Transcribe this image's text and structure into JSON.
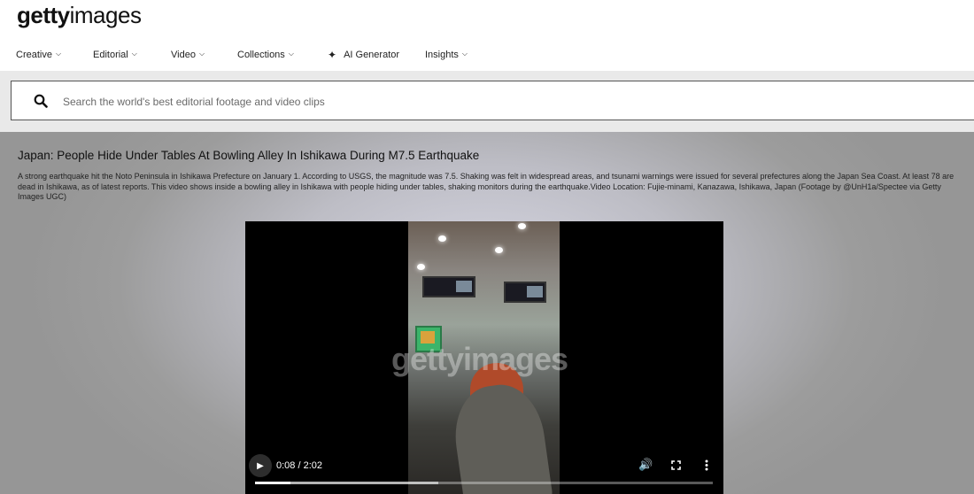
{
  "brand": {
    "logo_bold": "getty",
    "logo_light": "images"
  },
  "nav": {
    "items": [
      {
        "label": "Creative",
        "has_chevron": true
      },
      {
        "label": "Editorial",
        "has_chevron": true
      },
      {
        "label": "Video",
        "has_chevron": true
      },
      {
        "label": "Collections",
        "has_chevron": true
      },
      {
        "label": "AI Generator",
        "has_chevron": false,
        "icon": "sparkle-icon"
      },
      {
        "label": "Insights",
        "has_chevron": true
      }
    ]
  },
  "search": {
    "placeholder": "Search the world's best editorial footage and video clips",
    "value": ""
  },
  "clip": {
    "title": "Japan: People Hide Under Tables At Bowling Alley In Ishikawa During M7.5 Earthquake",
    "description": "A strong earthquake hit the Noto Peninsula in Ishikawa Prefecture on January 1. According to USGS, the magnitude was 7.5. Shaking was felt in widespread areas, and tsunami warnings were issued for several prefectures along the Japan Sea Coast. At least 78 are dead in Ishikawa, as of latest reports. This video shows inside a bowling alley in Ishikawa with people hiding under tables, shaking monitors during the earthquake.Video Location: Fujie-minami, Kanazawa, Ishikawa, Japan (Footage by @UnH1a/Spectee via Getty Images UGC)"
  },
  "player": {
    "time_display": "0:08 / 2:02",
    "watermark": "gettyimages",
    "played_fraction": 0.078,
    "buffered_fraction": 0.4
  },
  "colors": {
    "search_band": "#e9e9e9",
    "video_bg": "#000000"
  }
}
